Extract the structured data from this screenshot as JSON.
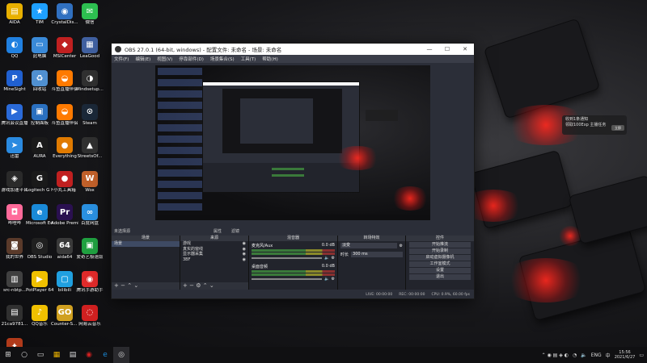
{
  "desktop": {
    "icons": [
      {
        "label": "AIDA",
        "glyph": "▤",
        "color": "#e8b000"
      },
      {
        "label": "TIM",
        "glyph": "★",
        "color": "#1ea0ff"
      },
      {
        "label": "CrystalDis...",
        "glyph": "◉",
        "color": "#3070c0"
      },
      {
        "label": "微信",
        "glyph": "✉",
        "color": "#2dbf50"
      },
      {
        "label": "QQ",
        "glyph": "◐",
        "color": "#2080e0"
      },
      {
        "label": "此电脑",
        "glyph": "▭",
        "color": "#3a8ad8"
      },
      {
        "label": "MSICenter",
        "glyph": "◆",
        "color": "#c02020"
      },
      {
        "label": "LeaGood",
        "glyph": "▦",
        "color": "#4060a0"
      },
      {
        "label": "MineSight",
        "glyph": "P",
        "color": "#2060d0"
      },
      {
        "label": "回收站",
        "glyph": "♻",
        "color": "#5090d0"
      },
      {
        "label": "斗鱼直播伴侣",
        "glyph": "◒",
        "color": "#ff7a00"
      },
      {
        "label": "Mindsetup...Iceland",
        "glyph": "◑",
        "color": "#303030"
      },
      {
        "label": "腾讯会议直播",
        "glyph": "▶",
        "color": "#2a6ad8"
      },
      {
        "label": "控制面板",
        "glyph": "▣",
        "color": "#2a70c0"
      },
      {
        "label": "斗鱼直播伴侣",
        "glyph": "◒",
        "color": "#ff7a00"
      },
      {
        "label": "Steam",
        "glyph": "⊙",
        "color": "#1b2838"
      },
      {
        "label": "迅雷",
        "glyph": "➤",
        "color": "#2a8ae0"
      },
      {
        "label": "AURA",
        "glyph": "A",
        "color": "#1a1a1a"
      },
      {
        "label": "Everything",
        "glyph": "●",
        "color": "#e07a00"
      },
      {
        "label": "StreetsOf...",
        "glyph": "▲",
        "color": "#303030"
      },
      {
        "label": "游戏加速平台",
        "glyph": "◈",
        "color": "#2a2a2a"
      },
      {
        "label": "Logitech G HUB",
        "glyph": "G",
        "color": "#1a1a1a"
      },
      {
        "label": "小丸工具箱",
        "glyph": "●",
        "color": "#c02020"
      },
      {
        "label": "Wox",
        "glyph": "W",
        "color": "#c0602a"
      },
      {
        "label": "哔哩哔",
        "glyph": "◘",
        "color": "#ff6a9a"
      },
      {
        "label": "Microsoft Edge",
        "glyph": "e",
        "color": "#1a8ad8"
      },
      {
        "label": "Adobe Premie...",
        "glyph": "Pr",
        "color": "#2a1050"
      },
      {
        "label": "百度网盘",
        "glyph": "∞",
        "color": "#2a90e0"
      },
      {
        "label": "我的世界",
        "glyph": "◙",
        "color": "#5a3a2a"
      },
      {
        "label": "OBS Studio",
        "glyph": "◎",
        "color": "#202020"
      },
      {
        "label": "aida64",
        "glyph": "64",
        "color": "#3a3a3a"
      },
      {
        "label": "爱奇艺极速版",
        "glyph": "▣",
        "color": "#20a040"
      },
      {
        "label": "src-nbtp...",
        "glyph": "▥",
        "color": "#404040"
      },
      {
        "label": "PotPlayer 64 bit",
        "glyph": "▶",
        "color": "#f0c000"
      },
      {
        "label": "bilibili",
        "glyph": "▢",
        "color": "#20a0e0"
      },
      {
        "label": "腾讯手游助手",
        "glyph": "◉",
        "color": "#e02a2a"
      },
      {
        "label": "21ca9781...",
        "glyph": "▤",
        "color": "#303030"
      },
      {
        "label": "QQ音乐",
        "glyph": "♪",
        "color": "#f0c000"
      },
      {
        "label": "Counter-S... Global Off...",
        "glyph": "GO",
        "color": "#d0a020"
      },
      {
        "label": "网易云音乐",
        "glyph": "◌",
        "color": "#d02020"
      },
      {
        "label": "地下城与勇士",
        "glyph": "✦",
        "color": "#b03a1a"
      }
    ]
  },
  "notification": {
    "line1": "收到1条通知",
    "line2": "领取100Exp 主播任务",
    "button": "立即"
  },
  "obs": {
    "title": "OBS 27.0.1 (64-bit, windows) - 配置文件: 未命名 - 场景: 未命名",
    "window_buttons": [
      "—",
      "☐",
      "✕"
    ],
    "menu": [
      "文件(F)",
      "编辑(E)",
      "视图(V)",
      "停靠部件(D)",
      "场景集合(S)",
      "工具(T)",
      "帮助(H)"
    ],
    "scene_tabs": {
      "current": "未选择源",
      "props": "属性",
      "filters": "滤镜"
    },
    "docks": {
      "scenes": {
        "title": "场景",
        "items": [
          "场景"
        ]
      },
      "sources": {
        "title": "来源",
        "items": [
          "游戏",
          "真实的窗线",
          "显示器采集",
          "3BF"
        ]
      },
      "mixer": {
        "title": "混音器",
        "channels": [
          {
            "name": "麦克风/Aux",
            "db": "0.0 dB"
          },
          {
            "name": "桌面音频",
            "db": "0.0 dB"
          }
        ]
      },
      "transitions": {
        "title": "转场特效",
        "type": "淡变",
        "duration_label": "时长",
        "duration": "300 ms"
      },
      "controls": {
        "title": "控件",
        "buttons": [
          "开始推流",
          "开始录制",
          "启动虚拟摄像机",
          "工作室模式",
          "设置",
          "退出"
        ]
      }
    },
    "status": {
      "live": "LIVE: 00:00:00",
      "rec": "REC: 00:00:00",
      "cpu": "CPU: 0.9%, 60.00 fps"
    }
  },
  "taskbar": {
    "start_icon": "⊞",
    "search_icon": "○",
    "taskview_icon": "▭",
    "pinned": [
      "▦",
      "▤",
      "◉",
      "e",
      "◎"
    ],
    "tray_lang": "ENG",
    "time": "15:56",
    "date": "2021/6/27"
  }
}
